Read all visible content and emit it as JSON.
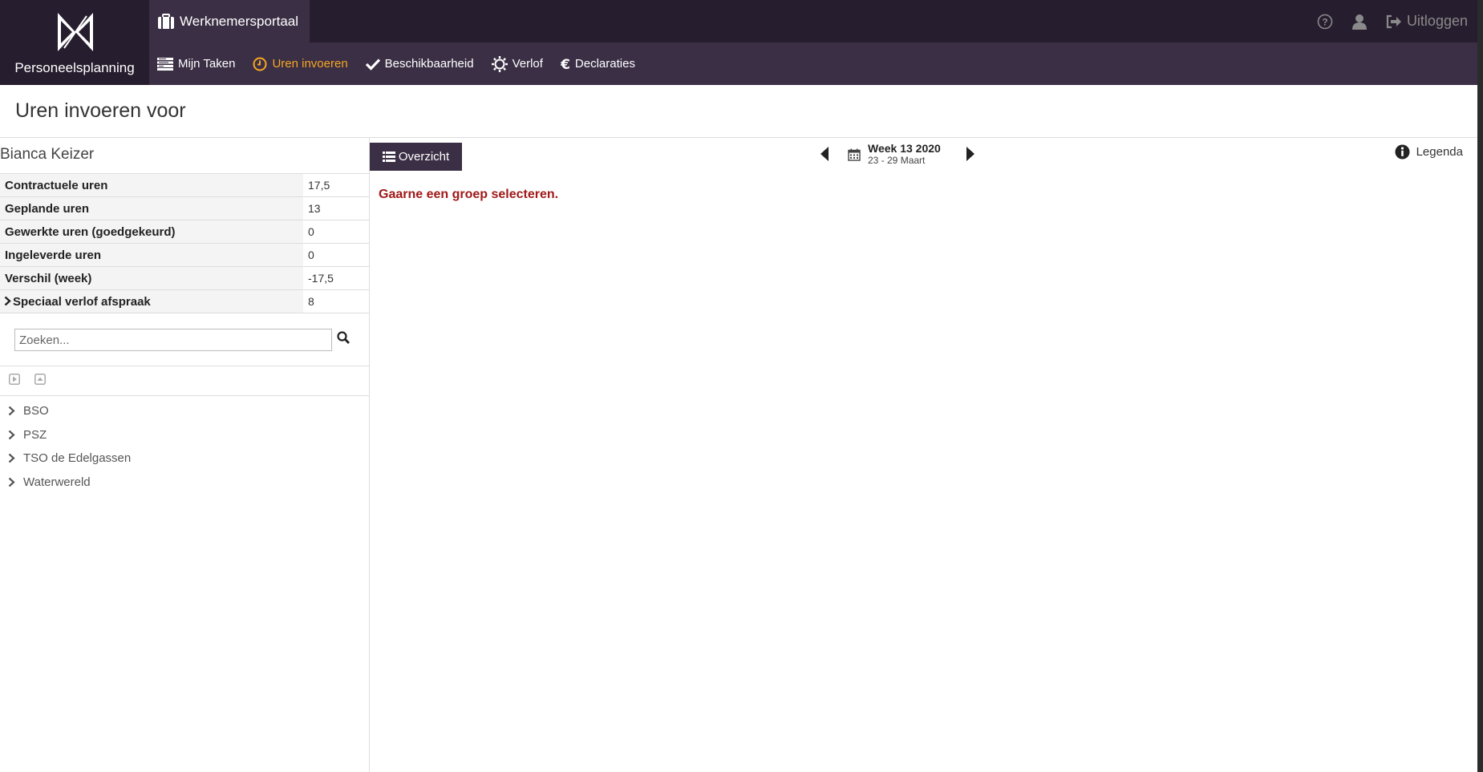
{
  "brand": {
    "name": "Personeelsplanning",
    "logo": "brand-logo"
  },
  "portal": {
    "label": "Werknemersportaal",
    "icon": "briefcase-icon"
  },
  "topright": {
    "help_icon": "question-circle-icon",
    "user_icon": "user-icon",
    "logout_label": "Uitloggen"
  },
  "nav": {
    "items": [
      {
        "label": "Mijn Taken",
        "icon": "tasks-icon",
        "active": false
      },
      {
        "label": "Uren invoeren",
        "icon": "clock-icon",
        "active": true
      },
      {
        "label": "Beschikbaarheid",
        "icon": "check-icon",
        "active": false
      },
      {
        "label": "Verlof",
        "icon": "sun-icon",
        "active": false
      },
      {
        "label": "Declaraties",
        "icon": "euro-icon",
        "active": false
      }
    ]
  },
  "page": {
    "title": "Uren invoeren voor"
  },
  "employee": {
    "name": "Bianca Keizer",
    "stats": [
      {
        "label": "Contractuele uren",
        "value": "17,5"
      },
      {
        "label": "Geplande uren",
        "value": "13"
      },
      {
        "label": "Gewerkte uren (goedgekeurd)",
        "value": "0"
      },
      {
        "label": "Ingeleverde uren",
        "value": "0"
      },
      {
        "label": "Verschil (week)",
        "value": "-17,5"
      },
      {
        "label": "Speciaal verlof afspraak",
        "value": "8",
        "expandable": true
      }
    ]
  },
  "search": {
    "placeholder": "Zoeken...",
    "value": ""
  },
  "groups": [
    "BSO",
    "PSZ",
    "TSO de Edelgassen",
    "Waterwereld"
  ],
  "main": {
    "overview_label": "Overzicht",
    "week_title": "Week 13 2020",
    "week_range": "23 - 29 Maart",
    "legend_label": "Legenda",
    "message": "Gaarne een groep selecteren."
  },
  "colors": {
    "nav_bg": "#3b2f45",
    "topbar_bg": "#261d2e",
    "active": "#f5a623",
    "message": "#a01818"
  }
}
